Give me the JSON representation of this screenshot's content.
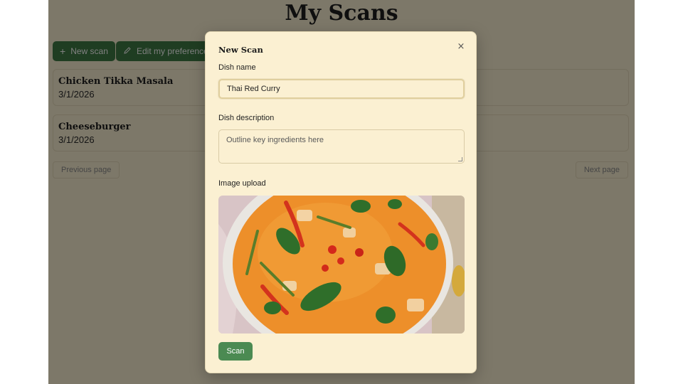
{
  "page": {
    "title": "My Scans",
    "new_scan_label": "New scan",
    "edit_prefs_label": "Edit my preferences",
    "scans": [
      {
        "name": "Chicken Tikka Masala",
        "date": "3/1/2026"
      },
      {
        "name": "Cheeseburger",
        "date": "3/1/2026"
      }
    ],
    "prev_label": "Previous page",
    "next_label": "Next page"
  },
  "modal": {
    "title": "New Scan",
    "close_icon": "×",
    "dish_name_label": "Dish name",
    "dish_name_value": "Thai Red Curry",
    "dish_desc_label": "Dish description",
    "dish_desc_placeholder": "Outline key ingredients here",
    "image_label": "Image upload",
    "scan_label": "Scan"
  },
  "icons": {
    "plus": "plus-icon",
    "pencil": "pencil-icon",
    "close": "close-icon"
  },
  "colors": {
    "accent_green": "#3f7a45",
    "background": "#fbf0d2",
    "overlay": "rgba(0,0,0,0.5)"
  }
}
